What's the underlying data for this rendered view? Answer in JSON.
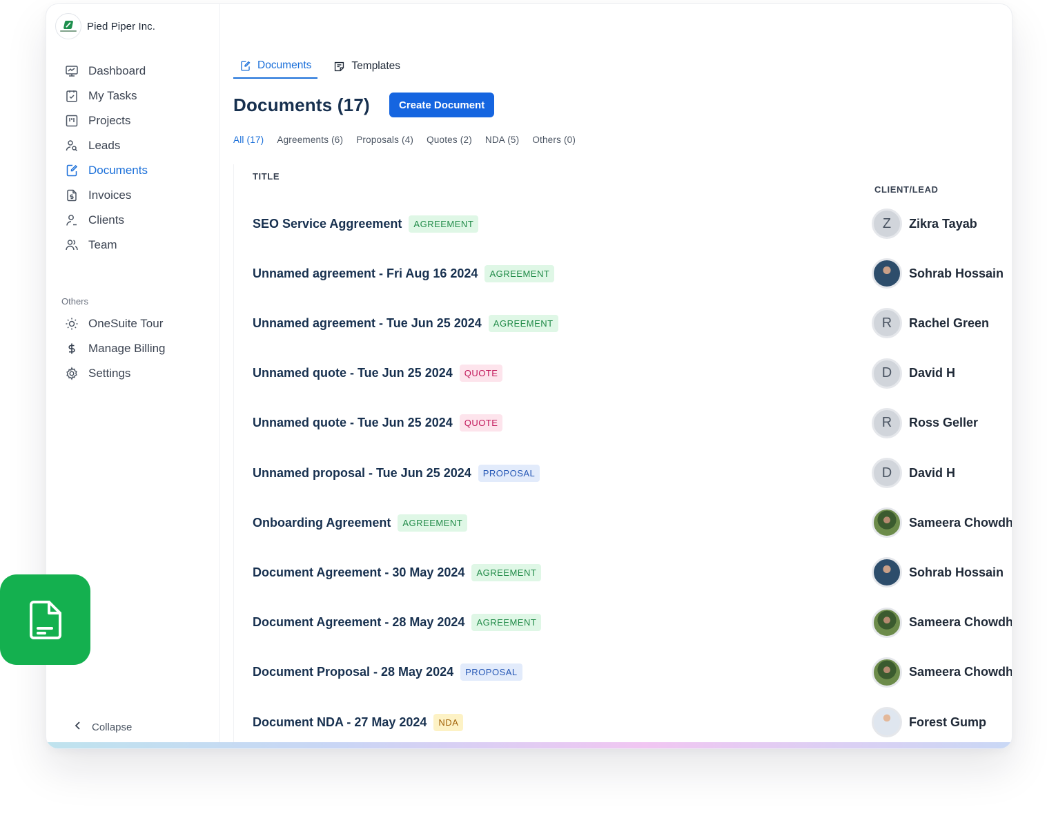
{
  "brand": {
    "name": "Pied Piper Inc."
  },
  "sidebar": {
    "items": [
      {
        "label": "Dashboard",
        "icon": "dashboard-icon",
        "active": false
      },
      {
        "label": "My Tasks",
        "icon": "tasks-icon",
        "active": false
      },
      {
        "label": "Projects",
        "icon": "projects-icon",
        "active": false
      },
      {
        "label": "Leads",
        "icon": "leads-icon",
        "active": false
      },
      {
        "label": "Documents",
        "icon": "documents-icon",
        "active": true
      },
      {
        "label": "Invoices",
        "icon": "invoice-icon",
        "active": false
      },
      {
        "label": "Clients",
        "icon": "clients-icon",
        "active": false
      },
      {
        "label": "Team",
        "icon": "team-icon",
        "active": false
      }
    ],
    "others_title": "Others",
    "others": [
      {
        "label": "OneSuite Tour",
        "icon": "sun-icon"
      },
      {
        "label": "Manage Billing",
        "icon": "dollar-icon"
      },
      {
        "label": "Settings",
        "icon": "gear-icon"
      }
    ],
    "collapse_label": "Collapse"
  },
  "tabs": [
    {
      "label": "Documents",
      "icon": "document-edit-icon",
      "active": true
    },
    {
      "label": "Templates",
      "icon": "template-icon",
      "active": false
    }
  ],
  "page": {
    "title": "Documents (17)",
    "create_button": "Create Document"
  },
  "filters": [
    {
      "label": "All (17)",
      "active": true
    },
    {
      "label": "Agreements (6)"
    },
    {
      "label": "Proposals (4)"
    },
    {
      "label": "Quotes (2)"
    },
    {
      "label": "NDA (5)"
    },
    {
      "label": "Others (0)"
    }
  ],
  "table": {
    "headers": {
      "title": "TITLE",
      "client": "CLIENT/LEAD"
    },
    "rows": [
      {
        "title": "SEO Service Aggreement",
        "badge": "AGREEMENT",
        "type": "agreement",
        "client": "Zikra Tayab",
        "initial": "Z",
        "avatar": "initial"
      },
      {
        "title": "Unnamed agreement - Fri Aug 16 2024",
        "badge": "AGREEMENT",
        "type": "agreement",
        "client": "Sohrab Hossain",
        "initial": "",
        "avatar": "photo-a"
      },
      {
        "title": "Unnamed agreement - Tue Jun 25 2024",
        "badge": "AGREEMENT",
        "type": "agreement",
        "client": "Rachel Green",
        "initial": "R",
        "avatar": "initial"
      },
      {
        "title": "Unnamed quote - Tue Jun 25 2024",
        "badge": "QUOTE",
        "type": "quote",
        "client": "David H",
        "initial": "D",
        "avatar": "initial"
      },
      {
        "title": "Unnamed quote - Tue Jun 25 2024",
        "badge": "QUOTE",
        "type": "quote",
        "client": "Ross Geller",
        "initial": "R",
        "avatar": "initial"
      },
      {
        "title": "Unnamed proposal - Tue Jun 25 2024",
        "badge": "PROPOSAL",
        "type": "proposal",
        "client": "David H",
        "initial": "D",
        "avatar": "initial"
      },
      {
        "title": "Onboarding Agreement",
        "badge": "AGREEMENT",
        "type": "agreement",
        "client": "Sameera Chowdhury",
        "initial": "",
        "avatar": "photo-b"
      },
      {
        "title": "Document Agreement - 30 May 2024",
        "badge": "AGREEMENT",
        "type": "agreement",
        "client": "Sohrab Hossain",
        "initial": "",
        "avatar": "photo-a"
      },
      {
        "title": "Document Agreement - 28 May 2024",
        "badge": "AGREEMENT",
        "type": "agreement",
        "client": "Sameera Chowdhury",
        "initial": "",
        "avatar": "photo-b"
      },
      {
        "title": "Document Proposal - 28 May 2024",
        "badge": "PROPOSAL",
        "type": "proposal",
        "client": "Sameera Chowdhury",
        "initial": "",
        "avatar": "photo-b"
      },
      {
        "title": "Document NDA - 27 May 2024",
        "badge": "NDA",
        "type": "nda",
        "client": "Forest Gump",
        "initial": "",
        "avatar": "photo-c"
      }
    ]
  },
  "colors": {
    "accent": "#1a6fd9",
    "button": "#1565e0",
    "app_tile": "#14b04f"
  }
}
